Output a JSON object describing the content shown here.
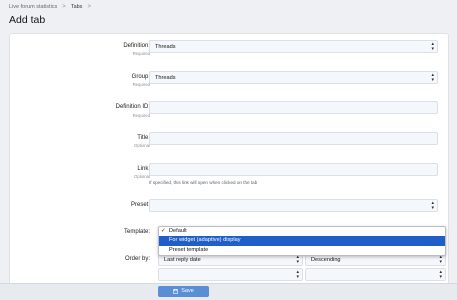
{
  "breadcrumb": {
    "items": [
      "Live forum statistics",
      "Tabs"
    ],
    "separator": ">"
  },
  "page": {
    "title": "Add tab"
  },
  "form": {
    "definition": {
      "label": "Definition:",
      "hint": "Required",
      "value": "Threads"
    },
    "group": {
      "label": "Group:",
      "hint": "Required",
      "value": "Threads"
    },
    "definition_id": {
      "label": "Definition ID:",
      "hint": "Required",
      "value": ""
    },
    "title": {
      "label": "Title:",
      "hint": "Optional",
      "value": ""
    },
    "link": {
      "label": "Link:",
      "hint": "Optional",
      "value": "",
      "explain": "If specified, this link will open when clicked on the tab"
    },
    "preset": {
      "label": "Preset:",
      "value": ""
    },
    "template": {
      "label": "Template:",
      "options": [
        {
          "label": "Default",
          "checked": true,
          "highlighted": false
        },
        {
          "label": "For widget (adaptive) display",
          "checked": false,
          "highlighted": true
        },
        {
          "label": "Preset template",
          "checked": false,
          "highlighted": false
        }
      ],
      "check_mark": "✓"
    },
    "order_by": {
      "label": "Order by:",
      "field": "Last reply date",
      "direction": "Descending"
    },
    "extra_row": {
      "left": "",
      "right": ""
    }
  },
  "actions": {
    "save_label": "Save"
  },
  "colors": {
    "accent": "#5a8fd6",
    "highlight": "#1f5fc7",
    "field_bg": "#f4f7fb"
  }
}
